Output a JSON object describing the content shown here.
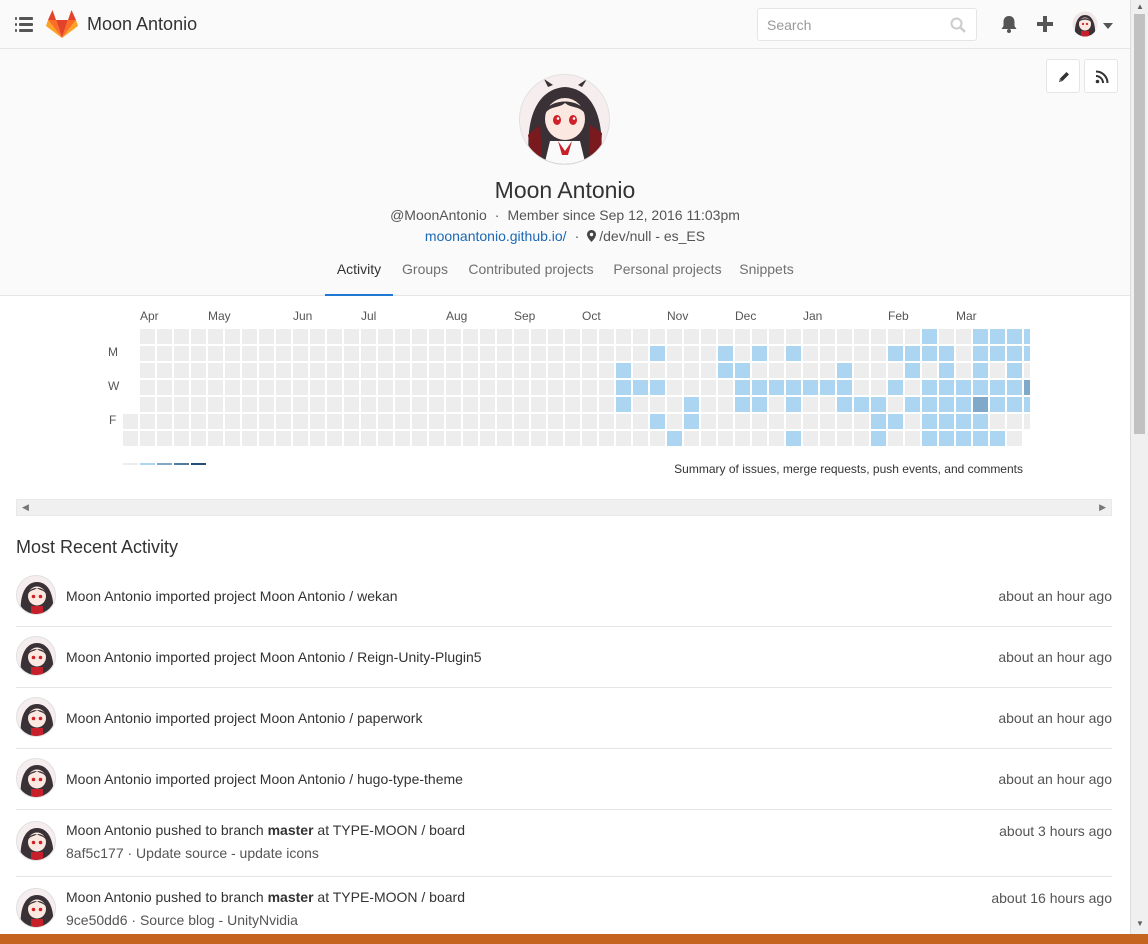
{
  "header": {
    "app_title": "Moon Antonio",
    "search_placeholder": "Search"
  },
  "profile": {
    "name": "Moon Antonio",
    "username": "@MoonAntonio",
    "member_since": "Member since Sep 12, 2016 11:03pm",
    "website": "moonantonio.github.io/",
    "location": "/dev/null - es_ES"
  },
  "tabs": [
    "Activity",
    "Groups",
    "Contributed projects",
    "Personal projects",
    "Snippets"
  ],
  "active_tab": "Activity",
  "calendar": {
    "months": [
      "Apr",
      "May",
      "Jun",
      "Jul",
      "Aug",
      "Sep",
      "Oct",
      "Nov",
      "Dec",
      "Jan",
      "Feb",
      "Mar"
    ],
    "day_labels": [
      "M",
      "W",
      "F"
    ],
    "summary": "Summary of issues, merge requests, push events, and comments",
    "colors": [
      "#ededed",
      "#acd5f2",
      "#7fa8c9",
      "#527ba0",
      "#254e77"
    ],
    "active_cells": {
      "29": [
        2,
        3,
        4
      ],
      "30": [
        3
      ],
      "31": [
        1,
        3,
        5
      ],
      "32": [
        6
      ],
      "33": [
        4,
        5
      ],
      "35": [
        1,
        2
      ],
      "36": [
        2,
        3,
        4
      ],
      "37": [
        1,
        3,
        4
      ],
      "38": [
        3
      ],
      "39": [
        1,
        3,
        4,
        6
      ],
      "40": [
        3
      ],
      "41": [
        3
      ],
      "42": [
        2,
        3,
        4
      ],
      "43": [
        4
      ],
      "44": [
        4,
        5,
        6
      ],
      "45": [
        1,
        3,
        5
      ],
      "46": [
        1,
        2,
        4
      ],
      "47": [
        0,
        1,
        3,
        4,
        5,
        6
      ],
      "48": [
        1,
        2,
        3,
        4,
        5,
        6
      ],
      "49": [
        3,
        4,
        5,
        6
      ],
      "50": [
        0,
        1,
        2,
        3,
        5,
        6
      ],
      "51": [
        0,
        1,
        3,
        4,
        6
      ],
      "52": [
        0,
        1,
        2,
        3,
        4
      ],
      "53": [
        0,
        1,
        3,
        4
      ]
    },
    "mid_cells": [
      [
        53,
        3
      ],
      [
        50,
        4
      ]
    ],
    "dark_cells": []
  },
  "activity": {
    "title": "Most Recent Activity",
    "events": [
      {
        "author": "Moon Antonio",
        "action": " imported project ",
        "strong": "",
        "after": "",
        "target": "Moon Antonio / wekan",
        "detail": "",
        "time": "about an hour ago"
      },
      {
        "author": "Moon Antonio",
        "action": " imported project ",
        "strong": "",
        "after": "",
        "target": "Moon Antonio / Reign-Unity-Plugin5",
        "detail": "",
        "time": "about an hour ago"
      },
      {
        "author": "Moon Antonio",
        "action": " imported project ",
        "strong": "",
        "after": "",
        "target": "Moon Antonio / paperwork",
        "detail": "",
        "time": "about an hour ago"
      },
      {
        "author": "Moon Antonio",
        "action": " imported project ",
        "strong": "",
        "after": "",
        "target": "Moon Antonio / hugo-type-theme",
        "detail": "",
        "time": "about an hour ago"
      },
      {
        "author": "Moon Antonio",
        "action": " pushed to branch ",
        "strong": "master",
        "after": " at ",
        "target": "TYPE-MOON / board",
        "detail": "8af5c177 · Update source - update icons",
        "time": "about 3 hours ago"
      },
      {
        "author": "Moon Antonio",
        "action": " pushed to branch ",
        "strong": "master",
        "after": " at ",
        "target": "TYPE-MOON / board",
        "detail": "9ce50dd6 · Source blog - UnityNvidia",
        "time": "about 16 hours ago"
      }
    ]
  }
}
